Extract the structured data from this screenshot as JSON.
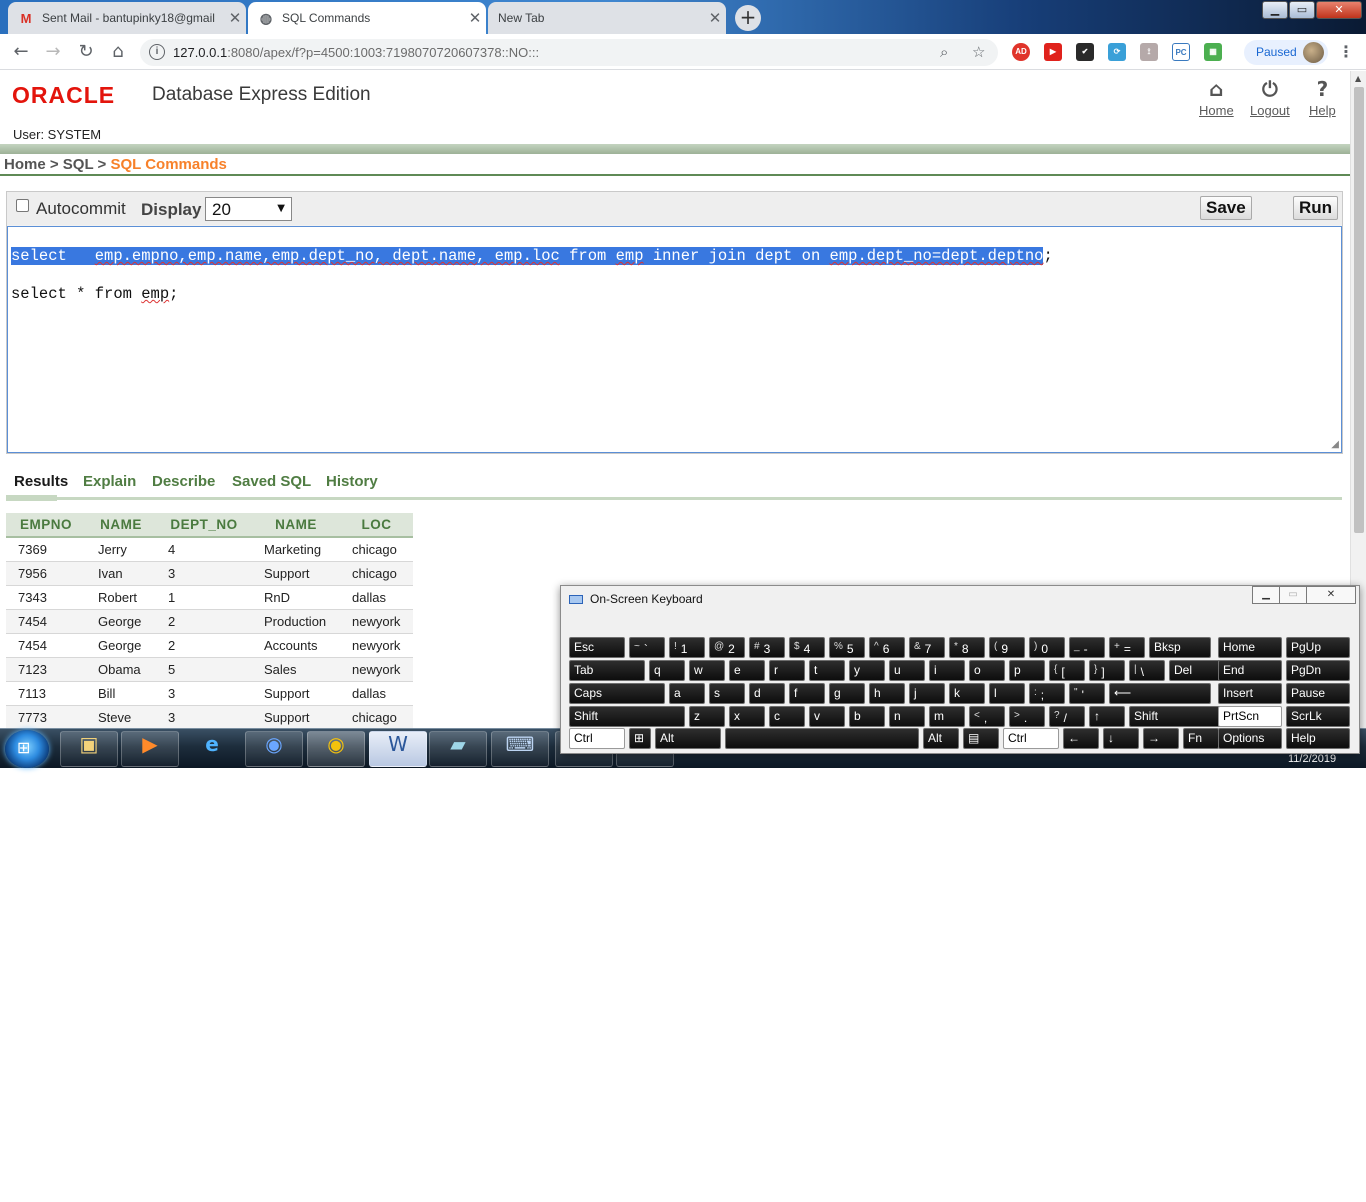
{
  "browser": {
    "tabs": [
      {
        "title": "Sent Mail - bantupinky18@gmail"
      },
      {
        "title": "SQL Commands"
      },
      {
        "title": "New Tab"
      }
    ],
    "url_host": "127.0.0.1",
    "url_rest": ":8080/apex/f?p=4500:1003:7198070720607378::NO:::",
    "profile_status": "Paused"
  },
  "header": {
    "logo": "ORACLE",
    "product": "Database Express Edition",
    "links": {
      "home": "Home",
      "logout": "Logout",
      "help": "Help"
    },
    "user": "User: SYSTEM"
  },
  "breadcrumb": {
    "home": "Home",
    "sep1": ">",
    "sql": "SQL",
    "sep2": ">",
    "current": "SQL Commands"
  },
  "editor": {
    "autocommit_label": "Autocommit",
    "display_label": "Display",
    "display_value": "20",
    "save_label": "Save",
    "run_label": "Run",
    "line1_kw": "select",
    "line1_sp": "   ",
    "line1_cols": "emp.empno,emp.name,emp.dept_no, dept.name, emp.loc",
    "line1_from": " from ",
    "line1_emp": "emp",
    "line1_join": " inner join dept on ",
    "line1_on": "emp.dept_no=dept.deptno",
    "line1_end": ";",
    "line2_start": "select * from ",
    "line2_emp": "emp",
    "line2_end": ";"
  },
  "result_tabs": [
    "Results",
    "Explain",
    "Describe",
    "Saved SQL",
    "History"
  ],
  "results": {
    "columns": [
      "EMPNO",
      "NAME",
      "DEPT_NO",
      "NAME",
      "LOC"
    ],
    "rows": [
      [
        "7369",
        "Jerry",
        "4",
        "Marketing",
        "chicago"
      ],
      [
        "7956",
        "Ivan",
        "3",
        "Support",
        "chicago"
      ],
      [
        "7343",
        "Robert",
        "1",
        "RnD",
        "dallas"
      ],
      [
        "7454",
        "George",
        "2",
        "Production",
        "newyork"
      ],
      [
        "7454",
        "George",
        "2",
        "Accounts",
        "newyork"
      ],
      [
        "7123",
        "Obama",
        "5",
        "Sales",
        "newyork"
      ],
      [
        "7113",
        "Bill",
        "3",
        "Support",
        "dallas"
      ],
      [
        "7773",
        "Steve",
        "3",
        "Support",
        "chicago"
      ]
    ]
  },
  "taskbar": {
    "clock": "11/2/2019"
  },
  "osk": {
    "title": "On-Screen Keyboard",
    "rows": [
      [
        [
          "Esc",
          ""
        ],
        [
          "~",
          "`"
        ],
        [
          "!",
          "1"
        ],
        [
          "@",
          "2"
        ],
        [
          "#",
          "3"
        ],
        [
          "$",
          "4"
        ],
        [
          "%",
          "5"
        ],
        [
          "^",
          "6"
        ],
        [
          "&",
          "7"
        ],
        [
          "*",
          "8"
        ],
        [
          "(",
          "9"
        ],
        [
          ")",
          "0"
        ],
        [
          "_",
          "-"
        ],
        [
          "+",
          "="
        ],
        [
          "Bksp",
          ""
        ],
        [
          "Home",
          ""
        ],
        [
          "PgUp",
          ""
        ]
      ],
      [
        [
          "Tab",
          ""
        ],
        [
          "q",
          ""
        ],
        [
          "w",
          ""
        ],
        [
          "e",
          ""
        ],
        [
          "r",
          ""
        ],
        [
          "t",
          ""
        ],
        [
          "y",
          ""
        ],
        [
          "u",
          ""
        ],
        [
          "i",
          ""
        ],
        [
          "o",
          ""
        ],
        [
          "p",
          ""
        ],
        [
          "{",
          "["
        ],
        [
          "}",
          "]"
        ],
        [
          "|",
          "\\"
        ],
        [
          "Del",
          ""
        ],
        [
          "End",
          ""
        ],
        [
          "PgDn",
          ""
        ]
      ],
      [
        [
          "Caps",
          ""
        ],
        [
          "a",
          ""
        ],
        [
          "s",
          ""
        ],
        [
          "d",
          ""
        ],
        [
          "f",
          ""
        ],
        [
          "g",
          ""
        ],
        [
          "h",
          ""
        ],
        [
          "j",
          ""
        ],
        [
          "k",
          ""
        ],
        [
          "l",
          ""
        ],
        [
          ":",
          ";"
        ],
        [
          "\"",
          "'"
        ],
        [
          "⟵",
          ""
        ],
        [
          "Insert",
          ""
        ],
        [
          "Pause",
          ""
        ]
      ],
      [
        [
          "Shift",
          ""
        ],
        [
          "z",
          ""
        ],
        [
          "x",
          ""
        ],
        [
          "c",
          ""
        ],
        [
          "v",
          ""
        ],
        [
          "b",
          ""
        ],
        [
          "n",
          ""
        ],
        [
          "m",
          ""
        ],
        [
          "<",
          ","
        ],
        [
          ">",
          "."
        ],
        [
          "?",
          "/"
        ],
        [
          "↑",
          ""
        ],
        [
          "Shift",
          ""
        ],
        [
          "PrtScn",
          ""
        ],
        [
          "ScrLk",
          ""
        ]
      ],
      [
        [
          "Ctrl",
          ""
        ],
        [
          "⊞",
          ""
        ],
        [
          "Alt",
          ""
        ],
        [
          "",
          ""
        ],
        [
          "Alt",
          ""
        ],
        [
          "▤",
          ""
        ],
        [
          "Ctrl",
          ""
        ],
        [
          "←",
          ""
        ],
        [
          "↓",
          ""
        ],
        [
          "→",
          ""
        ],
        [
          "Fn",
          ""
        ],
        [
          "Options",
          ""
        ],
        [
          "Help",
          ""
        ]
      ]
    ]
  }
}
